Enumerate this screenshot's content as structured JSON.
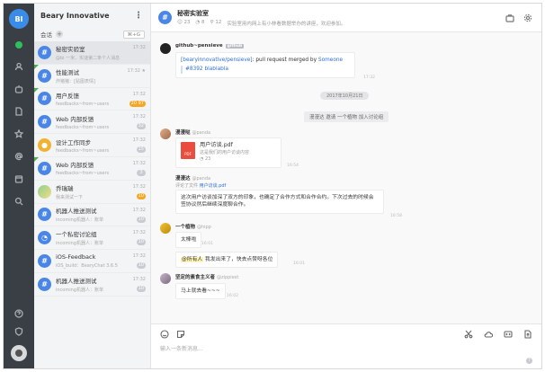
{
  "rail": {
    "avatar_text": "BI"
  },
  "sidebar": {
    "team_name": "Beary Innovative",
    "section_title": "会话",
    "add": "+",
    "shortcut": "⌘+G",
    "items": [
      {
        "name": "秘密实验室",
        "time": "17:32",
        "preview": "@bi 一米、实谜第二条个人消息",
        "badge": "",
        "icon": "#",
        "color": "blue"
      },
      {
        "name": "性能测试",
        "time": "17:32 ★",
        "preview": "炸猪猪：[贴图表情]",
        "badge": "",
        "icon": "#",
        "color": "blue"
      },
      {
        "name": "用户反馈",
        "time": "17:32",
        "preview": "feedbacks~from~users",
        "badge": "20 97",
        "icon": "#",
        "color": "blue"
      },
      {
        "name": "Web 内部反馈",
        "time": "17:32",
        "preview": "feedbacks~from~users",
        "badge": "32",
        "icon": "#",
        "color": "blue"
      },
      {
        "name": "设计工作同步",
        "time": "17:32",
        "preview": "feedbacks~from~users",
        "badge": "15",
        "icon": "●",
        "color": "yellow"
      },
      {
        "name": "Web 内部反馈",
        "time": "17:32",
        "preview": "feedbacks~from~users",
        "badge": "3",
        "icon": "#",
        "color": "blue"
      },
      {
        "name": "乔瑞瑞",
        "time": "17:32",
        "preview": "我来测试一下",
        "badge": "10",
        "icon": "",
        "color": "photo"
      },
      {
        "name": "机器人推送测试",
        "time": "17:32",
        "preview": "incoming机器人：账单",
        "badge": "10",
        "icon": "#",
        "color": "blue"
      },
      {
        "name": "一个私密讨论组",
        "time": "17:32",
        "preview": "incoming机器人：账单",
        "badge": "10",
        "icon": "◔",
        "color": "blue"
      },
      {
        "name": "iOS-Feedback",
        "time": "17:32",
        "preview": "iOS_build：BearyChat 3.6.5",
        "badge": "10",
        "icon": "#",
        "color": "blue"
      },
      {
        "name": "机器人推送测试",
        "time": "17:32",
        "preview": "incoming机器人：账单",
        "badge": "10",
        "icon": "#",
        "color": "blue"
      }
    ]
  },
  "channel": {
    "icon": "#",
    "title": "秘密实验室",
    "members": "23",
    "online": "8",
    "pins": "12",
    "topic": "实验室用内网上有小林看数据举办的讲座，欢迎参加。"
  },
  "messages": {
    "github_sender": "github~pensieve",
    "github_tag": "github",
    "github_line1_repo": "[bearyinnovative/pensieve]",
    "github_line1_text": ": pull request merged by ",
    "github_line1_user": "Someone",
    "github_line2": "#8392 blablabla",
    "github_time": "17:32",
    "date_divider": "2017年10月21日",
    "system_note": "漫漫达 邀请 一个植物 加入讨论组",
    "m1_sender": "漫漫哒",
    "m1_handle": "@panda",
    "file_name": "用户访谈.pdf",
    "file_desc": "这是我们的用户访谈内容",
    "file_type": "PDF",
    "file_count": "23",
    "m1_time": "16:54",
    "m2_sender": "漫漫达",
    "m2_handle": "@panda",
    "m2_reply_prefix": "评论了文件",
    "m2_reply_file": "用户访谈.pdf",
    "m2_text": "这次用户访谈加深了双方的印象，也确定了合作方式和合作合约。下次过去的时候会签协议然后继续深度聊合作。",
    "m2_time": "16:58",
    "m3_sender": "一个植物",
    "m3_handle": "@hipp",
    "m3_text": "太棒啦",
    "m3_time": "16:01",
    "m4_highlight": "@所有人",
    "m4_text": " 我发出来了，快去点赞呀各位",
    "m4_time": "16:01",
    "m5_sender": "坚定的素食主义者",
    "m5_handle": "@zippiest",
    "m5_text": "马上就去看~~~",
    "m5_time": "16:02"
  },
  "composer": {
    "placeholder": "输入一条新消息...",
    "help": "?"
  }
}
